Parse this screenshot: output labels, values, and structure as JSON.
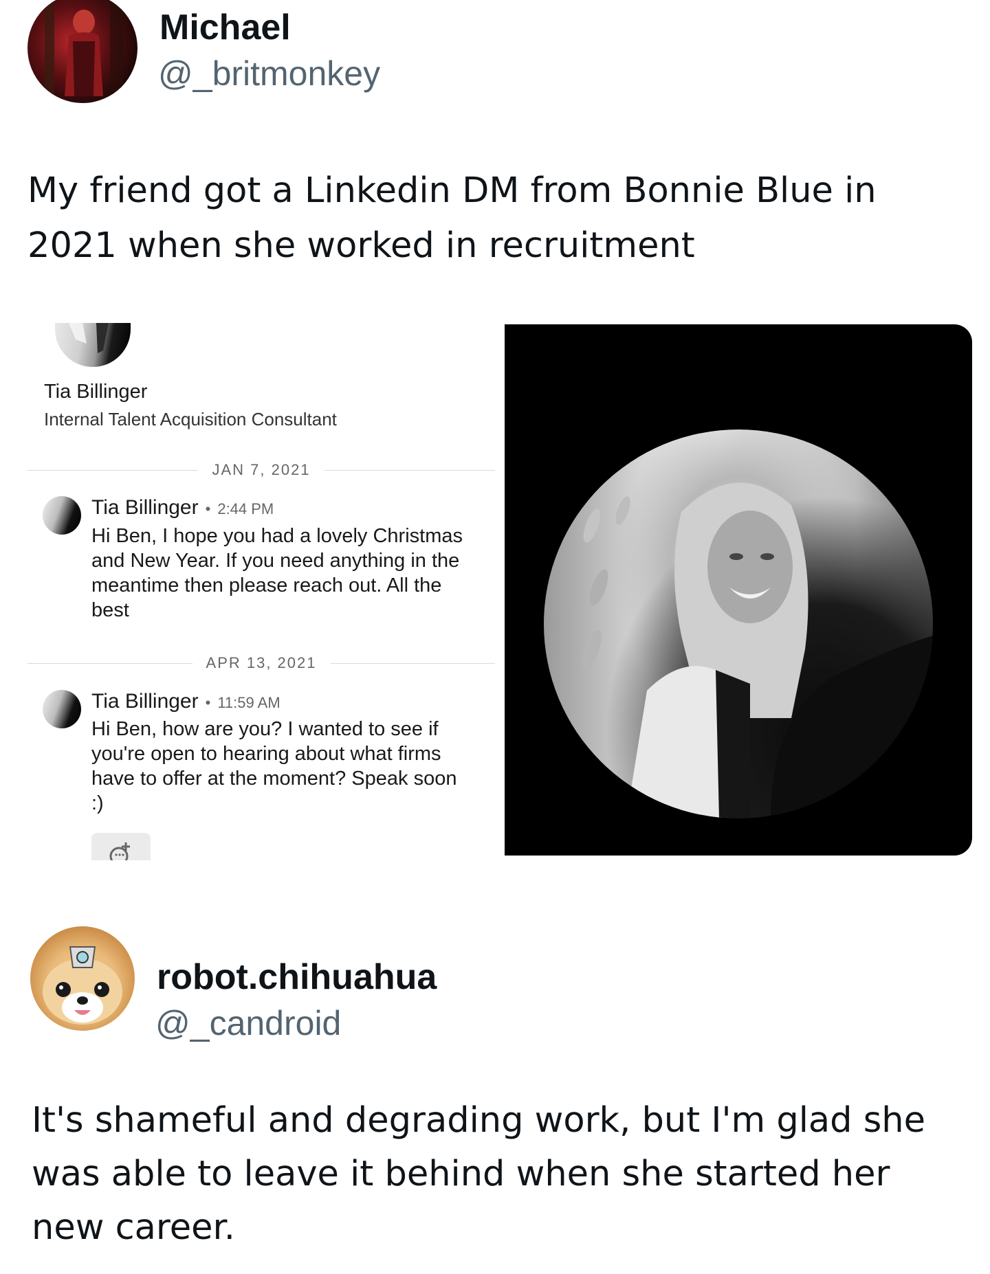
{
  "tweet1": {
    "author_name": "Michael",
    "author_handle": "@_britmonkey",
    "text": "My friend got a Linkedin DM from Bonnie Blue in 2021 when she worked in recruitment"
  },
  "linkedin": {
    "profile_name": "Tia Billinger",
    "profile_headline": "Internal Talent Acquisition Consultant",
    "messages": [
      {
        "date": "JAN 7, 2021",
        "sender": "Tia Billinger",
        "time": "2:44 PM",
        "text": "Hi Ben, I hope you had a lovely Christmas and New Year. If you need anything in the meantime then please reach out. All the best"
      },
      {
        "date": "APR 13, 2021",
        "sender": "Tia Billinger",
        "time": "11:59 AM",
        "text": "Hi Ben, how are you? I wanted to see if you're open to hearing about what firms have to offer at the moment? Speak soon :)"
      }
    ],
    "reaction_icon": "add-reaction-icon"
  },
  "tweet2": {
    "author_name": "robot.chihuahua",
    "author_handle": "@_candroid",
    "text": "It's shameful and degrading work, but  I'm glad she was able to leave it behind when she started her new career."
  },
  "colors": {
    "text_primary": "#0f1419",
    "text_secondary": "#536471",
    "photo_panel_bg": "#000000"
  }
}
